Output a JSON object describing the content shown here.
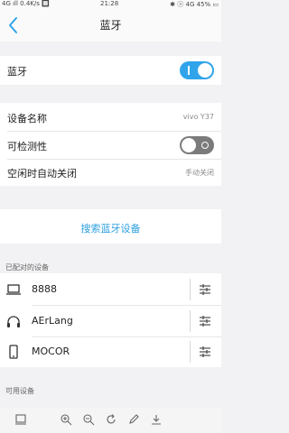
{
  "status_bar": {
    "left": "4G ıll 0.4K/s 🔲",
    "time": "21:28",
    "right": "✱ ⓥ 4G 45% ▭"
  },
  "header": {
    "title": "蓝牙"
  },
  "bluetooth": {
    "label": "蓝牙",
    "enabled": true
  },
  "settings": {
    "device_name_label": "设备名称",
    "device_name_value": "vivo Y37",
    "discoverable_label": "可检测性",
    "discoverable_enabled": false,
    "idle_off_label": "空闲时自动关闭",
    "idle_off_value": "手动关闭"
  },
  "search": {
    "label": "搜索蓝牙设备"
  },
  "paired": {
    "header": "已配对的设备",
    "devices": [
      {
        "name": "8888",
        "icon": "laptop-icon"
      },
      {
        "name": "AErLang",
        "icon": "headphones-icon"
      },
      {
        "name": "MOCOR",
        "icon": "phone-icon"
      }
    ]
  },
  "available": {
    "header": "可用设备"
  },
  "toolbar": {
    "icons": [
      "save-icon",
      "zoom-in-icon",
      "zoom-out-icon",
      "rotate-icon",
      "edit-icon",
      "download-icon"
    ]
  },
  "colors": {
    "accent": "#2fa4ea",
    "link": "#2d9fe0",
    "background": "#f2f2f4"
  }
}
